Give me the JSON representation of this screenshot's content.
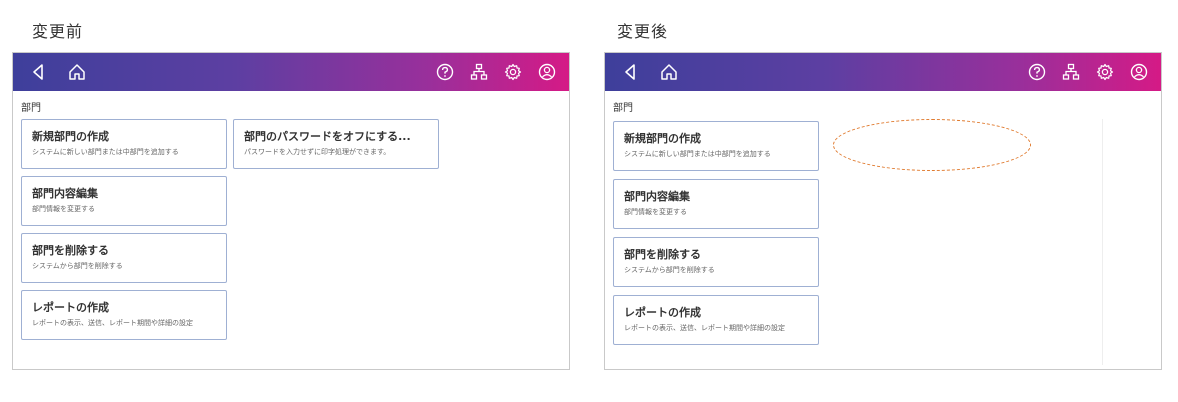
{
  "before": {
    "caption": "変更前",
    "section_title": "部門",
    "nav": [
      "back-icon",
      "home-icon"
    ],
    "toolbar_icons": [
      "help-icon",
      "network-icon",
      "settings-icon",
      "account-icon"
    ],
    "tiles": [
      {
        "title": "新規部門の作成",
        "desc": "システムに新しい部門または中部門を追加する"
      },
      {
        "title": "部門内容編集",
        "desc": "部門情報を変更する"
      },
      {
        "title": "部門を削除する",
        "desc": "システムから部門を削除する"
      },
      {
        "title": "レポートの作成",
        "desc": "レポートの表示、送信、レポート期間や詳細の設定"
      },
      {
        "title": "部門のパスワードをオフにする...",
        "desc": "パスワードを入力せずに印字処理ができます。"
      }
    ]
  },
  "after": {
    "caption": "変更後",
    "section_title": "部門",
    "nav": [
      "back-icon",
      "home-icon"
    ],
    "toolbar_icons": [
      "help-icon",
      "network-icon",
      "settings-icon",
      "account-icon"
    ],
    "tiles": [
      {
        "title": "新規部門の作成",
        "desc": "システムに新しい部門または中部門を追加する"
      },
      {
        "title": "部門内容編集",
        "desc": "部門情報を変更する"
      },
      {
        "title": "部門を削除する",
        "desc": "システムから部門を削除する"
      },
      {
        "title": "レポートの作成",
        "desc": "レポートの表示、送信、レポート期間や詳細の設定"
      }
    ],
    "highlight_color": "#e07a2e"
  },
  "colors": {
    "header_gradient_start": "#3e3f9b",
    "header_gradient_end": "#d51a86",
    "tile_border": "#9fb0d3"
  }
}
